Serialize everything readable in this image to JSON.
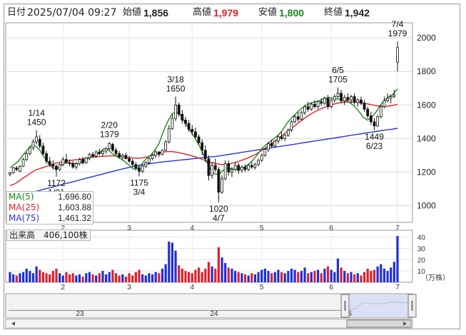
{
  "header": {
    "date_label": "日付",
    "datetime": "2025/07/04 09:27",
    "open_label": "始値",
    "open": "1,856",
    "high_label": "高値",
    "high": "1,979",
    "low_label": "安値",
    "low": "1,800",
    "close_label": "終値",
    "close": "1,942"
  },
  "colors": {
    "up": "#1f2fd8",
    "down": "#e0202c",
    "ma5": "#1a8a1a",
    "ma25": "#e0202c",
    "ma75": "#2a33d9",
    "high": "#e0202c",
    "low": "#1a8a1a"
  },
  "ma_legend": [
    {
      "name": "MA(5)",
      "value": "1,696.80",
      "color": "#1a8a1a"
    },
    {
      "name": "MA(25)",
      "value": "1,603.88",
      "color": "#e0202c"
    },
    {
      "name": "MA(75)",
      "value": "1,461.32",
      "color": "#2a33d9"
    }
  ],
  "volume_label": "出来高　406,100株",
  "volume_unit": "（万株）",
  "annotations": [
    {
      "date": "1/14",
      "price": "1450",
      "pos": "above"
    },
    {
      "date": "1/21",
      "price": "1172",
      "pos": "below"
    },
    {
      "date": "2/20",
      "price": "1379",
      "pos": "above"
    },
    {
      "date": "3/4",
      "price": "1175",
      "pos": "below"
    },
    {
      "date": "3/18",
      "price": "1650",
      "pos": "above"
    },
    {
      "date": "4/7",
      "price": "1020",
      "pos": "below"
    },
    {
      "date": "6/5",
      "price": "1705",
      "pos": "above"
    },
    {
      "date": "6/23",
      "price": "1449",
      "pos": "below"
    },
    {
      "date": "7/4",
      "price": "1979",
      "pos": "above"
    }
  ],
  "navigator": {
    "labels": [
      "23",
      "24",
      "5"
    ]
  },
  "chart_data": {
    "type": "candlestick",
    "x_month_labels": [
      "2",
      "3",
      "4",
      "5",
      "6",
      "7"
    ],
    "price_axis": {
      "ticks": [
        1000,
        1200,
        1400,
        1600,
        1800,
        2000
      ],
      "ylim": [
        900,
        2090
      ]
    },
    "volume_axis": {
      "ticks": [
        10,
        20,
        30,
        40
      ],
      "ylim": [
        0,
        46
      ],
      "unit": "万株"
    },
    "ohlc": [
      [
        1185,
        1200,
        1175,
        1195
      ],
      [
        1195,
        1230,
        1190,
        1225
      ],
      [
        1225,
        1235,
        1205,
        1215
      ],
      [
        1205,
        1240,
        1200,
        1235
      ],
      [
        1235,
        1285,
        1230,
        1275
      ],
      [
        1275,
        1320,
        1265,
        1310
      ],
      [
        1310,
        1355,
        1300,
        1345
      ],
      [
        1345,
        1395,
        1330,
        1380
      ],
      [
        1380,
        1450,
        1365,
        1410
      ],
      [
        1395,
        1420,
        1340,
        1355
      ],
      [
        1355,
        1375,
        1300,
        1310
      ],
      [
        1310,
        1325,
        1250,
        1265
      ],
      [
        1265,
        1290,
        1230,
        1245
      ],
      [
        1245,
        1270,
        1215,
        1235
      ],
      [
        1235,
        1245,
        1172,
        1215
      ],
      [
        1215,
        1255,
        1205,
        1245
      ],
      [
        1245,
        1290,
        1235,
        1275
      ],
      [
        1275,
        1310,
        1250,
        1260
      ],
      [
        1255,
        1275,
        1235,
        1250
      ],
      [
        1250,
        1265,
        1220,
        1230
      ],
      [
        1230,
        1260,
        1215,
        1250
      ],
      [
        1250,
        1285,
        1240,
        1275
      ],
      [
        1275,
        1290,
        1245,
        1255
      ],
      [
        1255,
        1290,
        1250,
        1285
      ],
      [
        1285,
        1315,
        1270,
        1305
      ],
      [
        1305,
        1320,
        1285,
        1295
      ],
      [
        1295,
        1330,
        1285,
        1320
      ],
      [
        1320,
        1340,
        1300,
        1310
      ],
      [
        1310,
        1335,
        1295,
        1325
      ],
      [
        1325,
        1350,
        1310,
        1340
      ],
      [
        1340,
        1379,
        1330,
        1370
      ],
      [
        1365,
        1375,
        1320,
        1330
      ],
      [
        1330,
        1345,
        1300,
        1310
      ],
      [
        1310,
        1325,
        1280,
        1290
      ],
      [
        1290,
        1310,
        1270,
        1300
      ],
      [
        1300,
        1315,
        1275,
        1280
      ],
      [
        1280,
        1295,
        1255,
        1265
      ],
      [
        1265,
        1280,
        1230,
        1245
      ],
      [
        1245,
        1260,
        1210,
        1225
      ],
      [
        1225,
        1240,
        1175,
        1205
      ],
      [
        1205,
        1245,
        1195,
        1235
      ],
      [
        1235,
        1265,
        1225,
        1255
      ],
      [
        1255,
        1290,
        1245,
        1280
      ],
      [
        1280,
        1310,
        1270,
        1300
      ],
      [
        1300,
        1330,
        1285,
        1320
      ],
      [
        1320,
        1325,
        1290,
        1305
      ],
      [
        1305,
        1335,
        1300,
        1330
      ],
      [
        1330,
        1390,
        1325,
        1380
      ],
      [
        1380,
        1480,
        1370,
        1460
      ],
      [
        1460,
        1545,
        1450,
        1520
      ],
      [
        1520,
        1650,
        1505,
        1600
      ],
      [
        1600,
        1615,
        1530,
        1545
      ],
      [
        1545,
        1570,
        1490,
        1510
      ],
      [
        1510,
        1530,
        1470,
        1490
      ],
      [
        1490,
        1510,
        1440,
        1455
      ],
      [
        1455,
        1480,
        1420,
        1440
      ],
      [
        1440,
        1465,
        1400,
        1410
      ],
      [
        1410,
        1425,
        1360,
        1375
      ],
      [
        1375,
        1395,
        1300,
        1330
      ],
      [
        1330,
        1360,
        1260,
        1280
      ],
      [
        1280,
        1300,
        1150,
        1180
      ],
      [
        1180,
        1260,
        1160,
        1240
      ],
      [
        1240,
        1280,
        1200,
        1215
      ],
      [
        1215,
        1230,
        1020,
        1080
      ],
      [
        1080,
        1180,
        1070,
        1160
      ],
      [
        1160,
        1270,
        1150,
        1250
      ],
      [
        1250,
        1270,
        1180,
        1200
      ],
      [
        1200,
        1230,
        1170,
        1215
      ],
      [
        1215,
        1260,
        1205,
        1240
      ],
      [
        1240,
        1255,
        1190,
        1210
      ],
      [
        1210,
        1240,
        1195,
        1230
      ],
      [
        1230,
        1245,
        1200,
        1215
      ],
      [
        1215,
        1250,
        1205,
        1240
      ],
      [
        1240,
        1260,
        1220,
        1230
      ],
      [
        1230,
        1255,
        1215,
        1245
      ],
      [
        1245,
        1280,
        1235,
        1270
      ],
      [
        1270,
        1310,
        1260,
        1300
      ],
      [
        1300,
        1345,
        1290,
        1335
      ],
      [
        1335,
        1380,
        1320,
        1370
      ],
      [
        1370,
        1395,
        1345,
        1355
      ],
      [
        1355,
        1390,
        1345,
        1385
      ],
      [
        1385,
        1420,
        1370,
        1410
      ],
      [
        1410,
        1440,
        1390,
        1400
      ],
      [
        1400,
        1425,
        1385,
        1420
      ],
      [
        1420,
        1460,
        1410,
        1450
      ],
      [
        1450,
        1510,
        1440,
        1500
      ],
      [
        1500,
        1545,
        1490,
        1530
      ],
      [
        1530,
        1560,
        1500,
        1515
      ],
      [
        1515,
        1565,
        1505,
        1555
      ],
      [
        1555,
        1600,
        1540,
        1590
      ],
      [
        1590,
        1620,
        1560,
        1575
      ],
      [
        1575,
        1615,
        1565,
        1605
      ],
      [
        1605,
        1630,
        1580,
        1590
      ],
      [
        1590,
        1625,
        1575,
        1620
      ],
      [
        1620,
        1640,
        1595,
        1610
      ],
      [
        1610,
        1650,
        1600,
        1640
      ],
      [
        1640,
        1660,
        1575,
        1590
      ],
      [
        1590,
        1640,
        1580,
        1630
      ],
      [
        1630,
        1665,
        1615,
        1650
      ],
      [
        1650,
        1705,
        1640,
        1670
      ],
      [
        1670,
        1690,
        1610,
        1625
      ],
      [
        1625,
        1660,
        1600,
        1645
      ],
      [
        1645,
        1670,
        1620,
        1630
      ],
      [
        1630,
        1660,
        1610,
        1650
      ],
      [
        1650,
        1670,
        1600,
        1615
      ],
      [
        1615,
        1640,
        1590,
        1630
      ],
      [
        1630,
        1650,
        1600,
        1610
      ],
      [
        1610,
        1630,
        1560,
        1575
      ],
      [
        1575,
        1590,
        1520,
        1535
      ],
      [
        1535,
        1560,
        1480,
        1500
      ],
      [
        1500,
        1520,
        1449,
        1475
      ],
      [
        1475,
        1540,
        1470,
        1530
      ],
      [
        1530,
        1600,
        1520,
        1590
      ],
      [
        1590,
        1650,
        1580,
        1625
      ],
      [
        1625,
        1670,
        1615,
        1640
      ],
      [
        1640,
        1660,
        1610,
        1650
      ],
      [
        1650,
        1690,
        1640,
        1660
      ],
      [
        1856,
        1979,
        1800,
        1942
      ]
    ],
    "volume": [
      9,
      7,
      6,
      8,
      9,
      12,
      10,
      8,
      14,
      11,
      9,
      8,
      7,
      10,
      12,
      8,
      6,
      9,
      7,
      8,
      6,
      7,
      5,
      8,
      9,
      7,
      6,
      8,
      10,
      7,
      9,
      11,
      8,
      6,
      7,
      5,
      8,
      6,
      9,
      11,
      7,
      6,
      8,
      7,
      9,
      8,
      12,
      16,
      36,
      35,
      28,
      15,
      12,
      10,
      9,
      8,
      11,
      13,
      9,
      12,
      18,
      14,
      12,
      31,
      22,
      17,
      13,
      12,
      10,
      9,
      8,
      7,
      6,
      8,
      7,
      9,
      11,
      12,
      10,
      8,
      9,
      11,
      9,
      8,
      10,
      12,
      11,
      9,
      10,
      13,
      8,
      9,
      10,
      11,
      8,
      12,
      14,
      11,
      9,
      21,
      13,
      10,
      8,
      9,
      7,
      8,
      6,
      9,
      12,
      10,
      11,
      14,
      16,
      12,
      10,
      13,
      18,
      41
    ],
    "ma5": [
      1225,
      1245,
      1265,
      1300,
      1330,
      1360,
      1355,
      1330,
      1290,
      1255,
      1225,
      1220,
      1240,
      1255,
      1255,
      1250,
      1250,
      1262,
      1275,
      1290,
      1300,
      1315,
      1340,
      1335,
      1310,
      1295,
      1280,
      1262,
      1240,
      1218,
      1222,
      1250,
      1280,
      1300,
      1330,
      1370,
      1440,
      1500,
      1545,
      1560,
      1540,
      1500,
      1460,
      1420,
      1380,
      1330,
      1270,
      1220,
      1190,
      1185,
      1210,
      1225,
      1220,
      1215,
      1220,
      1230,
      1245,
      1270,
      1300,
      1335,
      1360,
      1380,
      1400,
      1420,
      1450,
      1490,
      1520,
      1545,
      1570,
      1590,
      1605,
      1615,
      1620,
      1630,
      1640,
      1645,
      1640,
      1635,
      1630,
      1625,
      1610,
      1590,
      1560,
      1525,
      1510,
      1530,
      1560,
      1600,
      1630,
      1650,
      1665,
      1697
    ],
    "ma25": [
      1120,
      1130,
      1150,
      1170,
      1190,
      1210,
      1220,
      1230,
      1240,
      1250,
      1258,
      1262,
      1268,
      1272,
      1275,
      1280,
      1285,
      1290,
      1292,
      1295,
      1296,
      1297,
      1296,
      1292,
      1288,
      1284,
      1282,
      1284,
      1290,
      1300,
      1310,
      1318,
      1322,
      1322,
      1318,
      1312,
      1305,
      1298,
      1288,
      1278,
      1268,
      1258,
      1250,
      1245,
      1245,
      1250,
      1258,
      1268,
      1278,
      1290,
      1305,
      1322,
      1342,
      1362,
      1385,
      1408,
      1430,
      1452,
      1475,
      1498,
      1520,
      1540,
      1558,
      1572,
      1585,
      1595,
      1605,
      1612,
      1616,
      1618,
      1618,
      1616,
      1612,
      1606,
      1600,
      1594,
      1590,
      1592,
      1597,
      1604
    ],
    "ma75": [
      1045,
      1055,
      1065,
      1075,
      1085,
      1095,
      1105,
      1115,
      1125,
      1135,
      1145,
      1155,
      1165,
      1175,
      1185,
      1195,
      1205,
      1215,
      1224,
      1232,
      1240,
      1246,
      1252,
      1258,
      1262,
      1266,
      1270,
      1274,
      1278,
      1282,
      1286,
      1290,
      1294,
      1300,
      1306,
      1312,
      1318,
      1324,
      1330,
      1336,
      1342,
      1348,
      1354,
      1360,
      1366,
      1372,
      1378,
      1384,
      1390,
      1396,
      1402,
      1408,
      1414,
      1420,
      1426,
      1432,
      1438,
      1444,
      1450,
      1455,
      1461
    ]
  }
}
